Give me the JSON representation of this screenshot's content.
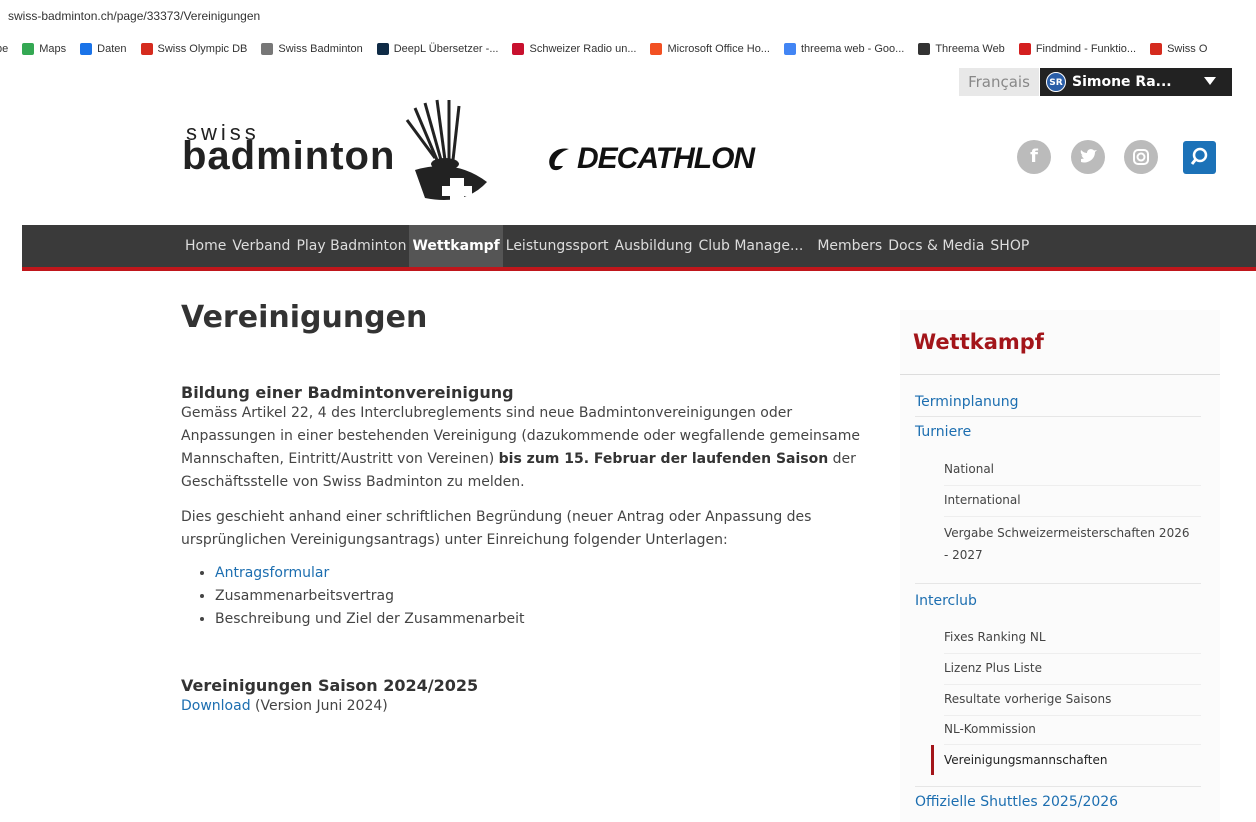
{
  "browser": {
    "url": "swiss-badminton.ch/page/33373/Vereinigungen",
    "bookmarks": [
      {
        "label": "be",
        "icon": "bookmark-icon",
        "color": "#888888"
      },
      {
        "label": "Maps",
        "icon": "maps-pin-icon",
        "color": "#34a853"
      },
      {
        "label": "Daten",
        "icon": "shield-icon",
        "color": "#1a73e8"
      },
      {
        "label": "Swiss Olympic DB",
        "icon": "swiss-cross-icon",
        "color": "#d52b1e"
      },
      {
        "label": "Swiss Badminton",
        "icon": "badminton-icon",
        "color": "#777777"
      },
      {
        "label": "DeepL Übersetzer -...",
        "icon": "deepl-icon",
        "color": "#0f2b46"
      },
      {
        "label": "Schweizer Radio un...",
        "icon": "srf-icon",
        "color": "#c8102e"
      },
      {
        "label": "Microsoft Office Ho...",
        "icon": "microsoft-icon",
        "color": "#f25022"
      },
      {
        "label": "threema web - Goo...",
        "icon": "google-icon",
        "color": "#4285f4"
      },
      {
        "label": "Threema Web",
        "icon": "threema-icon",
        "color": "#333333"
      },
      {
        "label": "Findmind - Funktio...",
        "icon": "findmind-icon",
        "color": "#d41f1f"
      },
      {
        "label": "Swiss O",
        "icon": "swiss-cross-icon",
        "color": "#d52b1e"
      }
    ]
  },
  "utility": {
    "language": "Français",
    "user_initials": "SR",
    "user_name": "Simone Ra..."
  },
  "header": {
    "logo_swiss": "swiss",
    "logo_badminton": "badminton",
    "sponsor": "DECATHLON",
    "social": [
      {
        "icon": "facebook-icon",
        "glyph": "f"
      },
      {
        "icon": "twitter-icon",
        "glyph": "t"
      },
      {
        "icon": "instagram-icon",
        "glyph": "◎"
      }
    ]
  },
  "nav": {
    "items": [
      "Home",
      "Verband",
      "Play Badminton",
      "Wettkampf",
      "Leistungssport",
      "Ausbildung",
      "Club Manage...",
      "Members",
      "Docs & Media",
      "SHOP"
    ],
    "active": "Wettkampf"
  },
  "main": {
    "title": "Vereinigungen",
    "section1_title": "Bildung einer Badmintonvereinigung",
    "para1_a": "Gemäss Artikel 22, 4 des Interclubreglements sind neue Badmintonvereinigungen oder Anpassungen in einer bestehenden Vereinigung (dazukommende oder wegfallende gemeinsame Mannschaften, Eintritt/Austritt von Vereinen) ",
    "para1_bold": "bis zum 15. Februar der laufenden Saison",
    "para1_b": " der Geschäftsstelle von Swiss Badminton zu melden.",
    "para2": "Dies geschieht anhand einer schriftlichen Begründung (neuer Antrag oder Anpassung des ursprünglichen Vereinigungsantrags) unter Einreichung folgender Unterlagen:",
    "list": [
      "Antragsformular",
      "Zusammenarbeitsvertrag",
      "Beschreibung und Ziel der Zusammenarbeit"
    ],
    "section2_title": "Vereinigungen Saison 2024/2025",
    "download_link": "Download",
    "download_note": " (Version Juni 2024)"
  },
  "sidebar": {
    "title": "Wettkampf",
    "terminplanung": "Terminplanung",
    "turniere": "Turniere",
    "turniere_sub": [
      "National",
      "International",
      "Vergabe Schweizermeisterschaften 2026 - 2027"
    ],
    "interclub": "Interclub",
    "interclub_sub": [
      "Fixes Ranking NL",
      "Lizenz Plus Liste",
      "Resultate vorherige Saisons",
      "NL-Kommission",
      "Vereinigungsmannschaften"
    ],
    "shuttles": "Offizielle Shuttles 2025/2026"
  },
  "colors": {
    "brand_red": "#a3151a",
    "link_blue": "#1c6eb0",
    "nav_bg": "#3a3a3a"
  }
}
